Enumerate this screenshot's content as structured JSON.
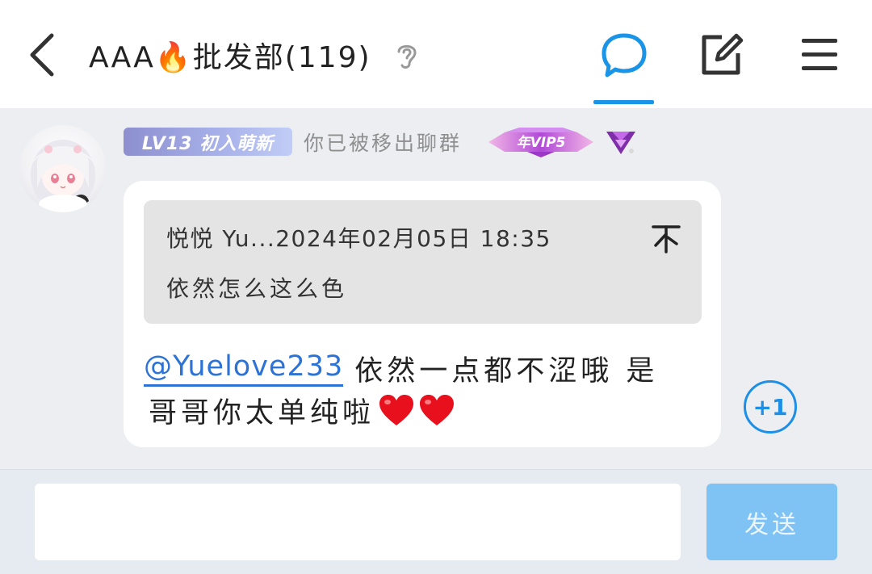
{
  "header": {
    "title": "AAA🔥批发部(119)",
    "icons": {
      "back": "back-arrow-icon",
      "ear": "ear-icon",
      "chat": "chat-bubble-icon",
      "edit": "edit-icon",
      "menu": "menu-icon"
    }
  },
  "message": {
    "level_badge": "LV13 初入萌新",
    "sender_name": "你已被移出聊群",
    "vip_badge": "年VIP5",
    "quote": {
      "meta": "悦悦  Yu...2024年02月05日 18:35",
      "text": "依然怎么这么色"
    },
    "mention": "@Yuelove233",
    "line1_text": "依然一点都不涩哦 是",
    "line2_text": "哥哥你太单纯啦",
    "plus_one": "+1"
  },
  "input": {
    "placeholder": "",
    "send_label": "发送"
  },
  "colors": {
    "accent": "#1a94e6",
    "mention": "#2d73d6",
    "send_button": "#7fc3f5",
    "level_badge": "#a9b3ea",
    "quote_bg": "#e4e4e4"
  }
}
